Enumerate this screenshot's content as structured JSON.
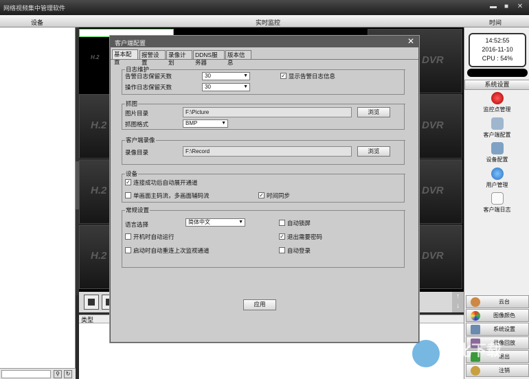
{
  "window": {
    "title": "网络视频集中管理软件",
    "min": "▬",
    "max": "■",
    "close": "✕"
  },
  "header": {
    "left": "设备",
    "center": "实时监控",
    "right": "时间"
  },
  "grid": {
    "labels": [
      "H.2",
      "DVR"
    ]
  },
  "log": {
    "column_type": "类型"
  },
  "clock": {
    "time": "14:52:55",
    "date": "2016-11-10",
    "cpu": "CPU : 54%"
  },
  "right_panel": {
    "section_title": "系统设置",
    "items": [
      "监控点管理",
      "客户端配置",
      "设备配置",
      "用户管理",
      "客户端日志"
    ],
    "bottom_buttons": [
      "云台",
      "图像颜色",
      "系统设置",
      "录像回放",
      "退出",
      "注销"
    ]
  },
  "dialog": {
    "title": "客户端配置",
    "close": "✕",
    "tabs": [
      "基本配置",
      "报警设置",
      "录像计划",
      "DDNS服务器",
      "版本信息"
    ],
    "log": {
      "group": "日志维护",
      "alarm_days_label": "告警日志保留天数",
      "alarm_days": "30",
      "op_days_label": "操作日志保留天数",
      "op_days": "30",
      "show_alarm_label": "显示告警日志信息",
      "show_alarm": true
    },
    "capture": {
      "group": "抓图",
      "dir_label": "图片目录",
      "dir": "F:\\Picture",
      "browse": "浏览",
      "format_label": "抓图格式",
      "format": "BMP"
    },
    "record": {
      "group": "客户端录像",
      "dir_label": "录像目录",
      "dir": "F:\\Record",
      "browse": "浏览"
    },
    "device": {
      "group": "设备",
      "auto_expand_label": "连接成功后自动展开通道",
      "auto_expand": true,
      "stream_label": "单画面主码流，多画面辅码流",
      "stream": false,
      "time_sync_label": "时间同步",
      "time_sync": true
    },
    "general": {
      "group": "常规设置",
      "lang_label": "语言选择",
      "lang": "简体中文",
      "autostart_label": "开机时自动运行",
      "autostart": false,
      "reconnect_label": "启动时自动重连上次监视通道",
      "reconnect": false,
      "autolock_label": "自动锁屏",
      "autolock": false,
      "exit_pwd_label": "退出需要密码",
      "exit_pwd": true,
      "autologin_label": "自动登录",
      "autologin": false
    },
    "apply": "应用"
  },
  "watermark": "优化下载"
}
